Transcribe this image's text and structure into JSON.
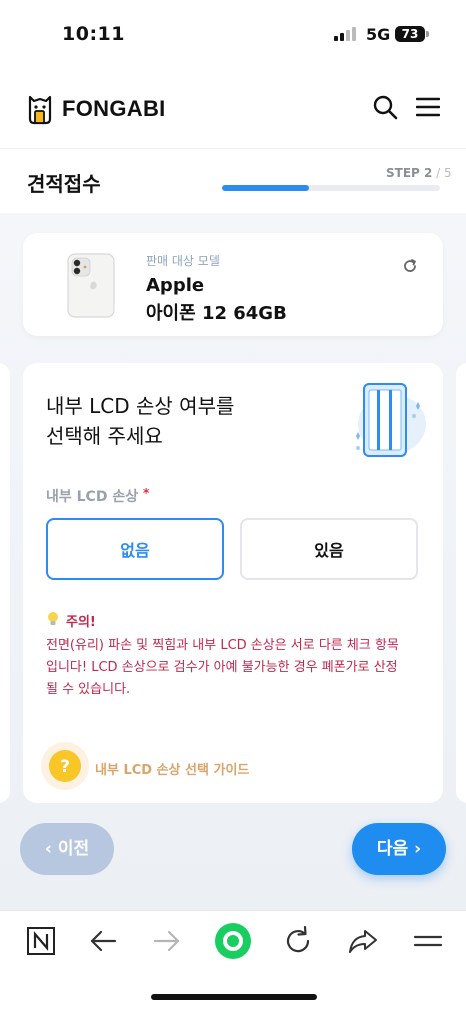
{
  "status_bar": {
    "time": "10:11",
    "network": "5G",
    "battery": "73"
  },
  "header": {
    "brand": "FONGABI",
    "icons": [
      "search-icon",
      "menu-icon"
    ]
  },
  "step": {
    "title": "견적접수",
    "prefix": "STEP ",
    "current": "2",
    "separator": " / ",
    "total": "5",
    "progress": 0.4
  },
  "model_card": {
    "caption": "판매 대상 모델",
    "brand": "Apple",
    "model": "아이폰 12 64GB"
  },
  "question": {
    "line1": "내부 LCD 손상 여부를",
    "line2": "선택해 주세요"
  },
  "field": {
    "label": "내부 LCD 손상",
    "required_mark": "*"
  },
  "options": {
    "no": "없음",
    "yes": "있음",
    "selected": "no"
  },
  "warning": {
    "title": "주의!",
    "line1": "전면(유리) 파손 및 찍힘과 내부 LCD 손상은 서로 다른 체크 항목",
    "line2": "입니다! LCD 손상으로 검수가 아예 불가능한 경우 폐폰가로 산정",
    "line3": "될 수 있습니다."
  },
  "guide": {
    "icon": "?",
    "label": "내부 LCD 손상 선택 가이드"
  },
  "nav": {
    "prev": "이전",
    "next": "다음"
  },
  "browser_bar": {
    "icons": [
      "naver-icon",
      "back-arrow-icon",
      "forward-arrow-icon",
      "home-circle-icon",
      "reload-icon",
      "share-icon",
      "menu-icon"
    ]
  },
  "colors": {
    "accent": "#2c8cf0",
    "warning": "#c1284e",
    "guide": "#d9a56a",
    "prev_button": "#b8c7e0"
  }
}
